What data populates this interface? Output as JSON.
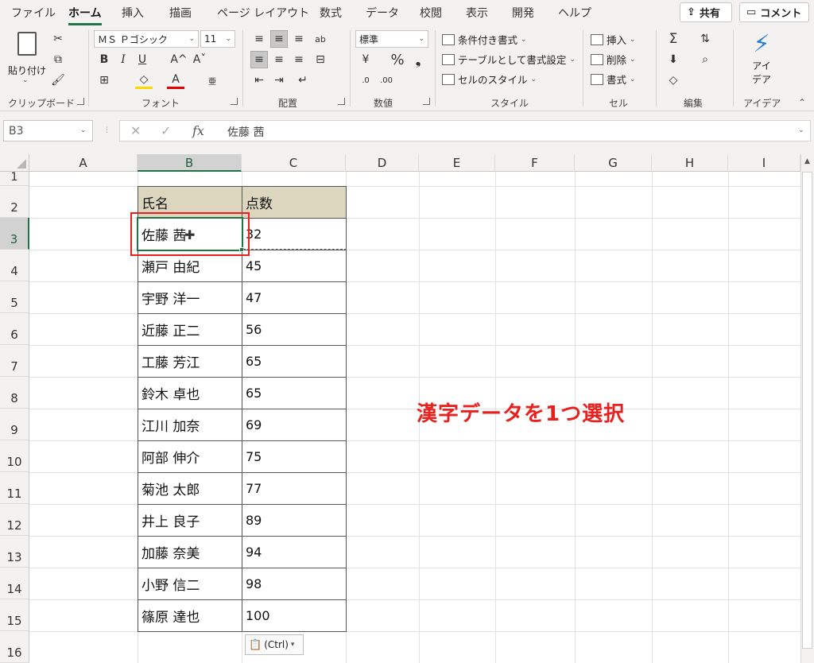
{
  "tabs": [
    "ファイル",
    "ホーム",
    "挿入",
    "描画",
    "ページ レイアウト",
    "数式",
    "データ",
    "校閲",
    "表示",
    "開発",
    "ヘルプ"
  ],
  "share": {
    "label": "共有"
  },
  "comment": {
    "label": "コメント"
  },
  "clipboard": {
    "paste_label": "貼り付け",
    "group_label": "クリップボード"
  },
  "font": {
    "name": "ＭＳ Ｐゴシック",
    "size": "11",
    "group_label": "フォント",
    "bold": "B",
    "italic": "I",
    "underline": "U",
    "grow": "A^",
    "shrink": "Aˇ"
  },
  "alignment": {
    "group_label": "配置"
  },
  "number": {
    "format": "標準",
    "group_label": "数値",
    "percent": "%",
    "comma": "❟"
  },
  "styles": {
    "conditional": "条件付き書式",
    "table": "テーブルとして書式設定",
    "cell_styles": "セルのスタイル",
    "group_label": "スタイル"
  },
  "cells": {
    "insert": "挿入",
    "delete": "削除",
    "format": "書式",
    "group_label": "セル"
  },
  "editing": {
    "group_label": "編集"
  },
  "ideas": {
    "label_line1": "アイ",
    "label_line2": "デア",
    "group_label": "アイデア"
  },
  "formula_bar": {
    "name_box": "B3",
    "fx": "fx",
    "content": "佐藤 茜"
  },
  "columns": [
    "A",
    "B",
    "C",
    "D",
    "E",
    "F",
    "G",
    "H",
    "I"
  ],
  "rows": [
    "1",
    "2",
    "3",
    "4",
    "5",
    "6",
    "7",
    "8",
    "9",
    "10",
    "11",
    "12",
    "13",
    "14",
    "15",
    "16"
  ],
  "table": {
    "headers": [
      "氏名",
      "点数"
    ],
    "rows": [
      {
        "name": "佐藤 茜",
        "score": "32"
      },
      {
        "name": "瀬戸 由紀",
        "score": "45"
      },
      {
        "name": "宇野 洋一",
        "score": "47"
      },
      {
        "name": "近藤 正二",
        "score": "56"
      },
      {
        "name": "工藤 芳江",
        "score": "65"
      },
      {
        "name": "鈴木 卓也",
        "score": "65"
      },
      {
        "name": "江川 加奈",
        "score": "69"
      },
      {
        "name": "阿部 伸介",
        "score": "75"
      },
      {
        "name": "菊池 太郎",
        "score": "77"
      },
      {
        "name": "井上 良子",
        "score": "89"
      },
      {
        "name": "加藤 奈美",
        "score": "94"
      },
      {
        "name": "小野 信二",
        "score": "98"
      },
      {
        "name": "篠原 達也",
        "score": "100"
      }
    ]
  },
  "annotation": "漢字データを1つ選択",
  "paste_options": {
    "label": "(Ctrl)"
  },
  "colors": {
    "accent": "#217346",
    "header_fill": "#ddd6be",
    "annotation": "#e8211e"
  }
}
